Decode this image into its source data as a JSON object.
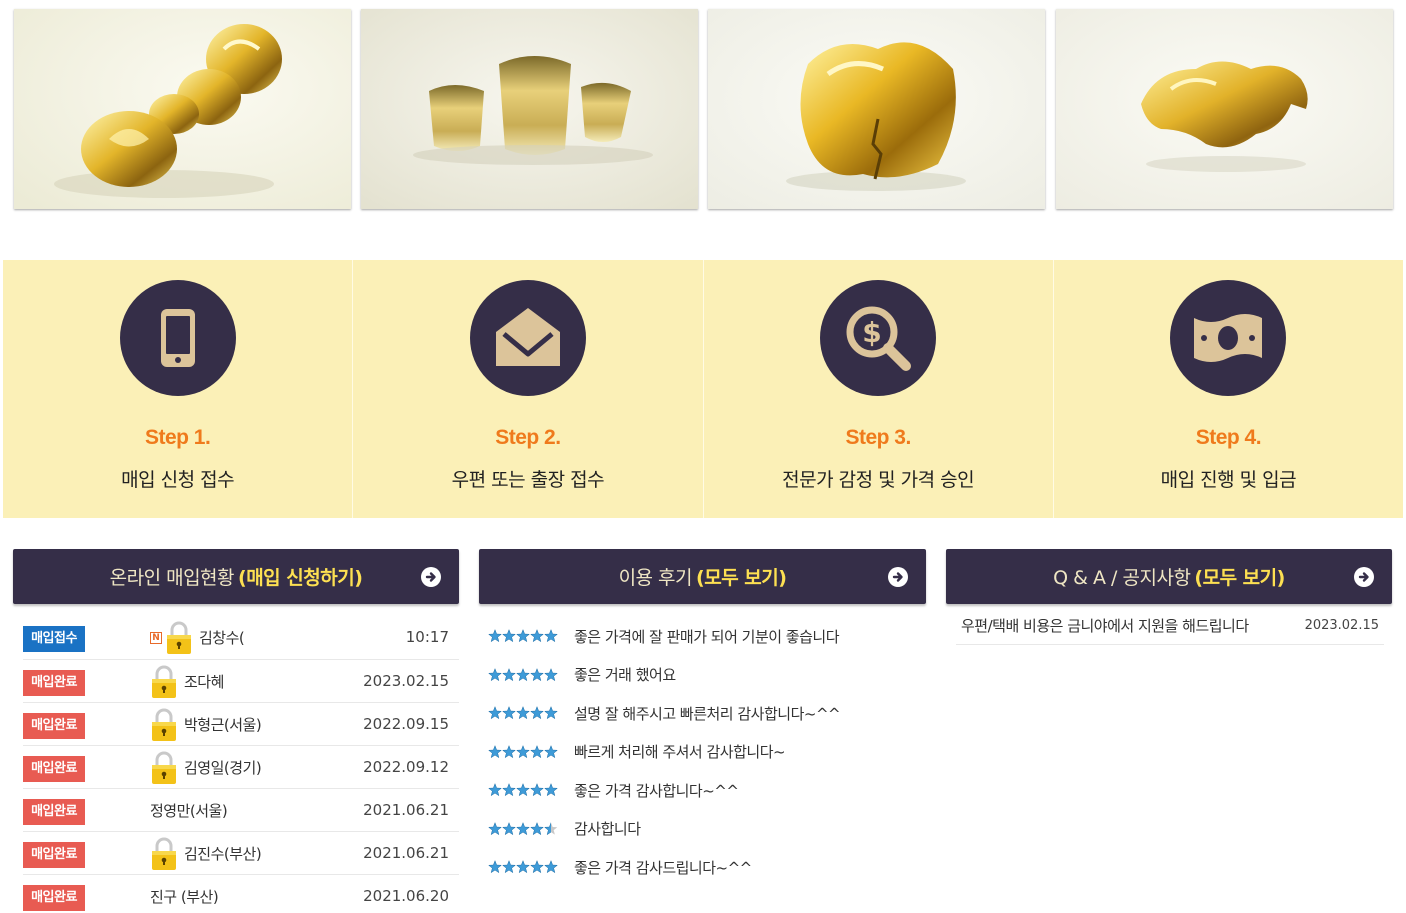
{
  "gallery": {
    "images": [
      {
        "icon": "gold-bridge-photo"
      },
      {
        "icon": "gold-crowns-photo"
      },
      {
        "icon": "gold-crown-photo"
      },
      {
        "icon": "gold-inlay-photo"
      }
    ]
  },
  "steps": [
    {
      "num": "Step 1.",
      "desc": "매입 신청 접수",
      "icon": "smartphone-icon"
    },
    {
      "num": "Step 2.",
      "desc": "우편 또는 출장 접수",
      "icon": "envelope-icon"
    },
    {
      "num": "Step 3.",
      "desc": "전문가 감정 및 가격 승인",
      "icon": "dollar-search-icon"
    },
    {
      "num": "Step 4.",
      "desc": "매입 진행 및 입금",
      "icon": "money-bill-icon"
    }
  ],
  "purchase": {
    "title": "온라인 매입현황",
    "link": "(매입 신청하기)",
    "rows": [
      {
        "badge": "매입접수",
        "status": "received",
        "name": "김창수(",
        "date": "10:17",
        "is_new": true,
        "locked": true,
        "new_mark": "N"
      },
      {
        "badge": "매입완료",
        "status": "done",
        "name": "조다혜",
        "date": "2023.02.15",
        "locked": true
      },
      {
        "badge": "매입완료",
        "status": "done",
        "name": "박형근(서울)",
        "date": "2022.09.15",
        "locked": true
      },
      {
        "badge": "매입완료",
        "status": "done",
        "name": "김영일(경기)",
        "date": "2022.09.12",
        "locked": true
      },
      {
        "badge": "매입완료",
        "status": "done",
        "name": "정영만(서울)",
        "date": "2021.06.21",
        "locked": false
      },
      {
        "badge": "매입완료",
        "status": "done",
        "name": "김진수(부산)",
        "date": "2021.06.21",
        "locked": true
      },
      {
        "badge": "매입완료",
        "status": "done",
        "name": "진구 (부산)",
        "date": "2021.06.20",
        "locked": false
      }
    ]
  },
  "reviews": {
    "title": "이용 후기",
    "link": "(모두 보기)",
    "rows": [
      {
        "rating": 5,
        "text": "좋은 가격에 잘 판매가 되어 기분이 좋습니다"
      },
      {
        "rating": 5,
        "text": "좋은 거래 했어요"
      },
      {
        "rating": 5,
        "text": "설명 잘 해주시고 빠른처리 감사합니다~^^"
      },
      {
        "rating": 5,
        "text": "빠르게 처리해 주셔서 감사합니다~"
      },
      {
        "rating": 5,
        "text": "좋은 가격 감사합니다~^^"
      },
      {
        "rating": 4.5,
        "text": "감사합니다"
      },
      {
        "rating": 5,
        "text": "좋은 가격 감사드립니다~^^"
      }
    ]
  },
  "qna": {
    "title": "Q & A / 공지사항",
    "link": "(모두 보기)",
    "rows": [
      {
        "title": "우편/택배 비용은 금니야에서 지원을 해드립니다",
        "date": "2023.02.15"
      }
    ]
  },
  "colors": {
    "panel_header": "#352e48",
    "step_bg": "#fbf0b7",
    "step_accent": "#ef7a1c",
    "link_yellow": "#fde052",
    "badge_blue": "#1a72c4",
    "badge_red": "#e85b52",
    "star": "#3e9bd8"
  }
}
